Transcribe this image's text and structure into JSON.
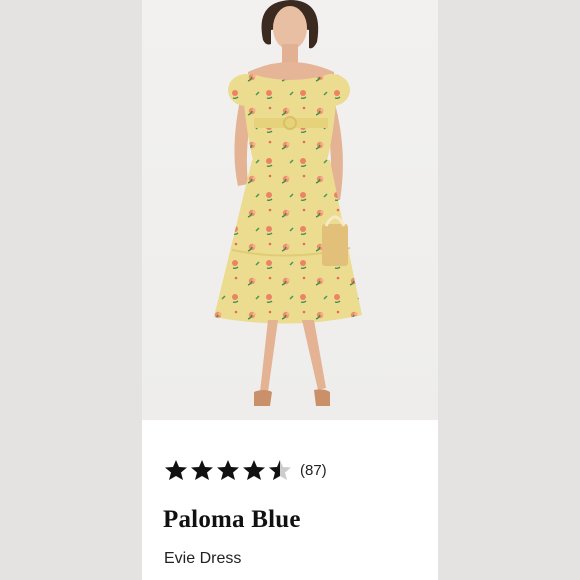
{
  "listing": {
    "brand": "Paloma Blue",
    "product_name": "Evie Dress",
    "rating": {
      "value": 4.5,
      "max": 5,
      "count_text": "(87)",
      "star_color": "#111111"
    }
  },
  "image": {
    "subject": "model-wearing-yellow-floral-midi-dress",
    "dress_color": "#ecdc8f",
    "flower_color": "#ef8f6a",
    "leaf_color": "#3f8a50",
    "background_color": "#f0efed"
  }
}
